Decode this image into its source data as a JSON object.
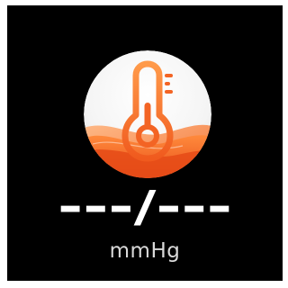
{
  "app": {
    "icon": "thermometer-icon",
    "accent_color": "#f0621e",
    "background_color": "#000000"
  },
  "measurement": {
    "value": "---/---",
    "unit": "mmHg"
  }
}
